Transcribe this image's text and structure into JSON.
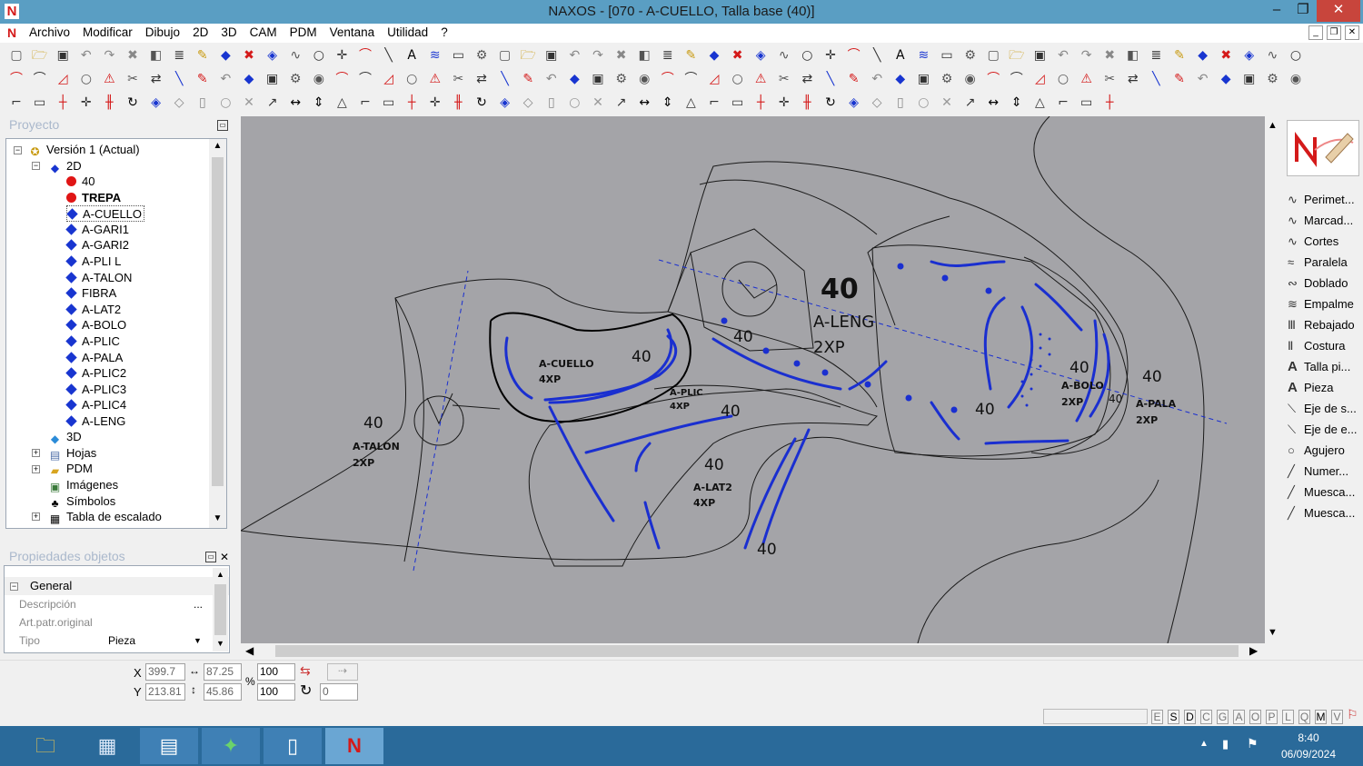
{
  "window": {
    "title": "NAXOS - [070 - A-CUELLO, Talla base (40)]",
    "minimize": "–",
    "restore": "❐",
    "close": "✕"
  },
  "menu": {
    "items": [
      "Archivo",
      "Modificar",
      "Dibujo",
      "2D",
      "3D",
      "CAM",
      "PDM",
      "Ventana",
      "Utilidad",
      "?"
    ]
  },
  "project_panel": {
    "title": "Proyecto",
    "version": "Versión 1 (Actual)",
    "node_2d": "2D",
    "pieces": [
      {
        "label": "40",
        "color": "red"
      },
      {
        "label": "TREPA",
        "color": "red",
        "bold": true
      },
      {
        "label": "A-CUELLO",
        "color": "blue",
        "selected": true
      },
      {
        "label": "A-GARI1",
        "color": "blue"
      },
      {
        "label": "A-GARI2",
        "color": "blue"
      },
      {
        "label": "A-PLI L",
        "color": "blue"
      },
      {
        "label": "A-TALON",
        "color": "blue"
      },
      {
        "label": "FIBRA",
        "color": "blue"
      },
      {
        "label": "A-LAT2",
        "color": "blue"
      },
      {
        "label": "A-BOLO",
        "color": "blue"
      },
      {
        "label": "A-PLIC",
        "color": "blue"
      },
      {
        "label": "A-PALA",
        "color": "blue"
      },
      {
        "label": "A-PLIC2",
        "color": "blue"
      },
      {
        "label": "A-PLIC3",
        "color": "blue"
      },
      {
        "label": "A-PLIC4",
        "color": "blue"
      },
      {
        "label": "A-LENG",
        "color": "blue"
      }
    ],
    "node_3d": "3D",
    "hojas": "Hojas",
    "pdm": "PDM",
    "imagenes": "Imágenes",
    "simbolos": "Símbolos",
    "tabla": "Tabla de escalado"
  },
  "properties_panel": {
    "title": "Propiedades objetos",
    "group": "General",
    "rows": [
      {
        "label": "Descripción",
        "value": ""
      },
      {
        "label": "Art.patr.original",
        "value": ""
      },
      {
        "label": "Tipo",
        "value": "Pieza"
      }
    ]
  },
  "right_panel": {
    "items": [
      {
        "label": "Perimet...",
        "icon": "curve-icon"
      },
      {
        "label": "Marcad...",
        "icon": "curve-icon"
      },
      {
        "label": "Cortes",
        "icon": "curve-icon"
      },
      {
        "label": "Paralela",
        "icon": "parallel-icon"
      },
      {
        "label": "Doblado",
        "icon": "fold-icon"
      },
      {
        "label": "Empalme",
        "icon": "join-icon"
      },
      {
        "label": "Rebajado",
        "icon": "skive-icon"
      },
      {
        "label": "Costura",
        "icon": "seam-icon"
      },
      {
        "label": "Talla pi...",
        "icon": "text-a-icon"
      },
      {
        "label": "Pieza",
        "icon": "text-a-icon"
      },
      {
        "label": "Eje de s...",
        "icon": "axis-icon"
      },
      {
        "label": "Eje de e...",
        "icon": "axis-icon"
      },
      {
        "label": "Agujero",
        "icon": "circle-icon"
      },
      {
        "label": "Numer...",
        "icon": "notch-icon"
      },
      {
        "label": "Muesca...",
        "icon": "notch-icon"
      },
      {
        "label": "Muesca...",
        "icon": "notch-icon"
      }
    ]
  },
  "coords": {
    "x_label": "X",
    "y_label": "Y",
    "x": "399.7",
    "y": "213.81",
    "w": "87.25",
    "h": "45.86",
    "scale_x": "100",
    "scale_y": "100",
    "pct": "%",
    "rotation": "0"
  },
  "status_letters": [
    "E",
    "S",
    "D",
    "C",
    "G",
    "A",
    "O",
    "P",
    "L",
    "Q",
    "M",
    "V"
  ],
  "drawing": {
    "labels": [
      {
        "text": "40",
        "size": "big"
      },
      {
        "text": "A-LENG",
        "size": "med"
      },
      {
        "text": "2XP",
        "size": "med"
      },
      {
        "text": "A-CUELLO"
      },
      {
        "text": "4XP"
      },
      {
        "text": "40"
      },
      {
        "text": "A-PLIC"
      },
      {
        "text": "4XP"
      },
      {
        "text": "40"
      },
      {
        "text": "40"
      },
      {
        "text": "A-TALON"
      },
      {
        "text": "2XP"
      },
      {
        "text": "40"
      },
      {
        "text": "A-LAT2"
      },
      {
        "text": "4XP"
      },
      {
        "text": "40"
      },
      {
        "text": "40"
      },
      {
        "text": "A-BOLO"
      },
      {
        "text": "2XP"
      },
      {
        "text": "40"
      },
      {
        "text": "A-PALA"
      },
      {
        "text": "2XP"
      },
      {
        "text": "40"
      },
      {
        "text": "40"
      },
      {
        "text": "40"
      }
    ]
  },
  "clock": {
    "time": "8:40",
    "date": "06/09/2024"
  },
  "colors": {
    "titlebar": "#5a9ec3",
    "canvas": "#a4a4a8",
    "piece_line": "#1a2fd0",
    "taskbar": "#2a6a9a"
  }
}
